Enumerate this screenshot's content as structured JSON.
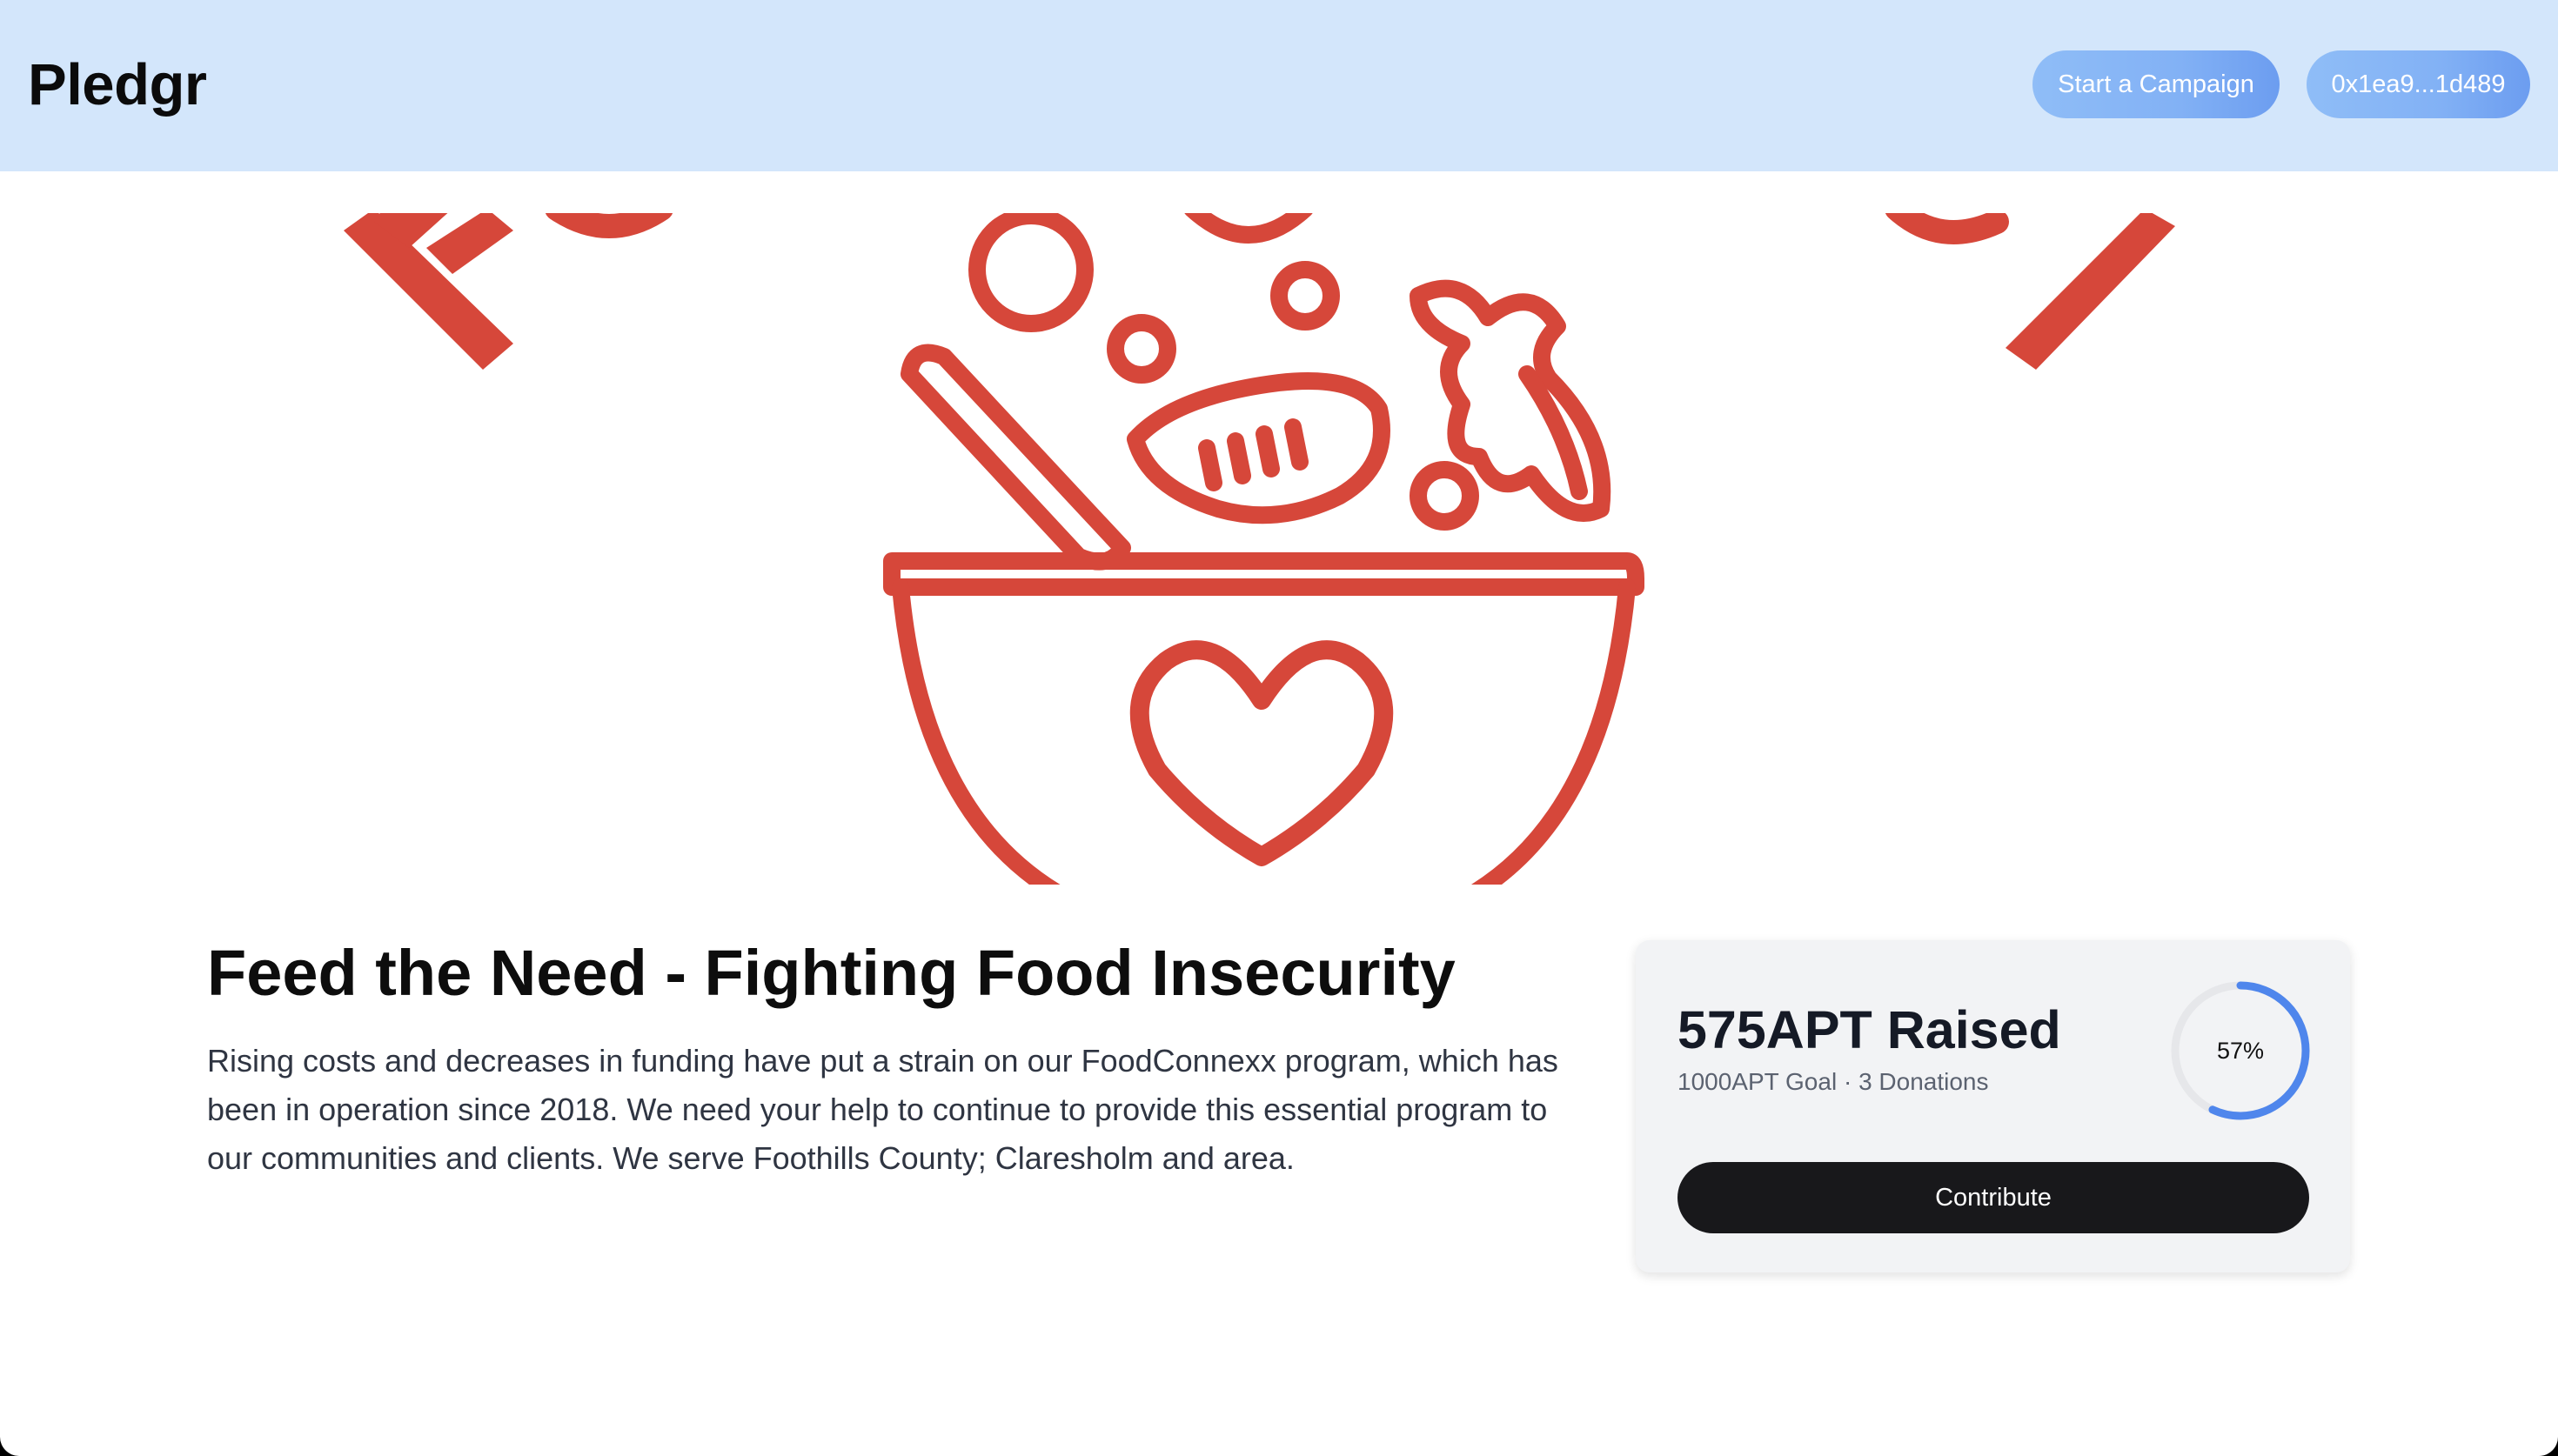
{
  "header": {
    "logo": "Pledgr",
    "start_campaign_label": "Start a Campaign",
    "wallet_label": "0x1ea9...1d489"
  },
  "campaign": {
    "title": "Feed the Need - Fighting Food Insecurity",
    "description": "Rising costs and decreases in funding have put a strain on our FoodConnexx program, which has been in operation since 2018. We need your help to continue to provide this essential program to our communities and clients. We serve Foothills County; Claresholm and area.",
    "hero_icon": "bowl-with-heart-icon"
  },
  "donation": {
    "raised_label": "575APT Raised",
    "goal_label": "1000APT Goal",
    "separator": "·",
    "donations_label": "3 Donations",
    "progress_percent": 57,
    "progress_label": "57%",
    "contribute_label": "Contribute"
  },
  "colors": {
    "header_bg": "#d3e6fb",
    "button_blue": "#82b1f5",
    "hero_red": "#d6473a",
    "ring_blue": "#4f86ec",
    "ring_track": "#e6e7ea",
    "contribute_bg": "#18181b"
  }
}
